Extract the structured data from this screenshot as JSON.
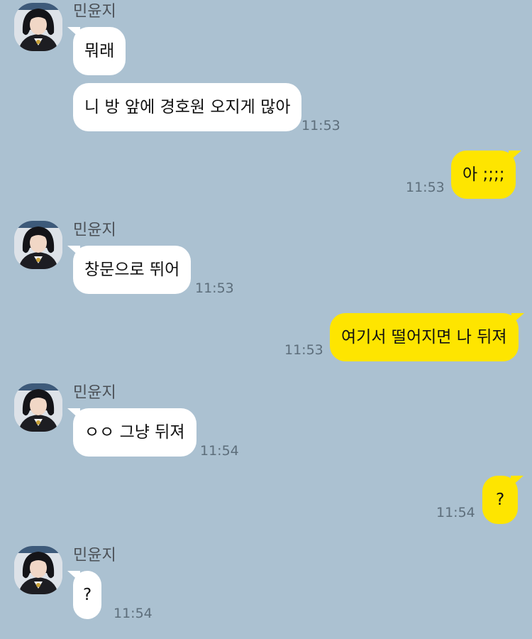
{
  "colors": {
    "background": "#abc1d1",
    "incoming_bubble": "#ffffff",
    "outgoing_bubble": "#fee500"
  },
  "sender_name": "민윤지",
  "avatar_icon": "profile-photo",
  "messages": [
    {
      "direction": "incoming",
      "text": "뭐래"
    },
    {
      "direction": "incoming",
      "text": "니 방 앞에 경호원 오지게 많아",
      "time": "11:53"
    },
    {
      "direction": "outgoing",
      "text": "아 ;;;;",
      "time": "11:53"
    },
    {
      "direction": "incoming",
      "text": "창문으로 뛰어",
      "time": "11:53"
    },
    {
      "direction": "outgoing",
      "text": "여기서 떨어지면 나 뒤져",
      "time": "11:53"
    },
    {
      "direction": "incoming",
      "text": "ㅇㅇ 그냥 뒤져",
      "time": "11:54"
    },
    {
      "direction": "outgoing",
      "text": "?",
      "time": "11:54"
    },
    {
      "direction": "incoming",
      "text": "?",
      "time": "11:54"
    }
  ]
}
